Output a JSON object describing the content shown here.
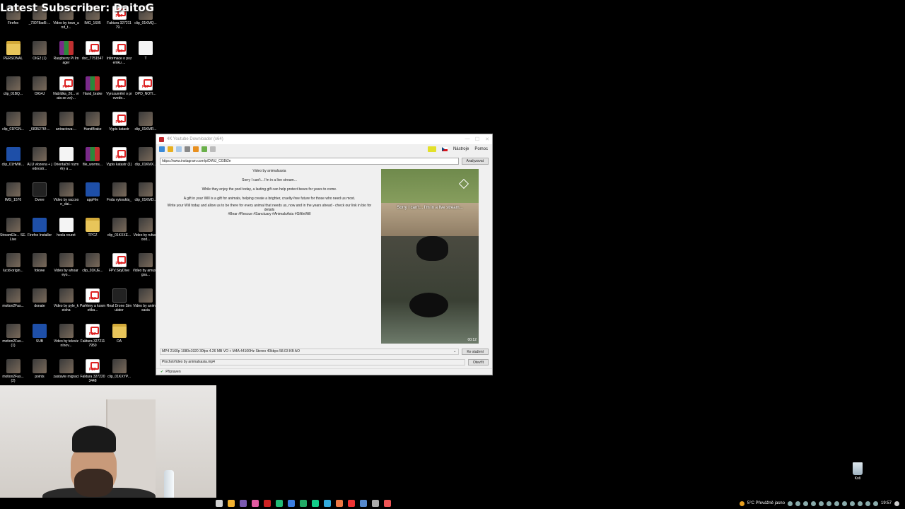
{
  "stream_overlay": {
    "latest_subscriber": "Latest Subscriber: DaitoG"
  },
  "desktop_icons": [
    {
      "label": "Firefox",
      "type": "thumb"
    },
    {
      "label": "_73078ad5-...",
      "type": "thumb"
    },
    {
      "label": "Video by tows_and_t...",
      "type": "thumb"
    },
    {
      "label": "IMG_1605",
      "type": "thumb"
    },
    {
      "label": "Faktura 32721179...",
      "type": "pdf"
    },
    {
      "label": "clip_01KMQ...",
      "type": "thumb"
    },
    {
      "label": "PERSONAL",
      "type": "folder"
    },
    {
      "label": "OIG2 (1)",
      "type": "thumb"
    },
    {
      "label": "Raspberry Pi Imager",
      "type": "rar"
    },
    {
      "label": "doc_7751547",
      "type": "pdf"
    },
    {
      "label": "Informace o pozemku ...",
      "type": "pdf"
    },
    {
      "label": "T",
      "type": "white"
    },
    {
      "label": "clip_01BQ...",
      "type": "thumb"
    },
    {
      "label": "OIG4J",
      "type": "thumb"
    },
    {
      "label": "Nabídka_26... vrata se zvý...",
      "type": "pdf"
    },
    {
      "label": "Hand_brake",
      "type": "rar"
    },
    {
      "label": "Vyrozumění o provede...",
      "type": "pdf"
    },
    {
      "label": "DPD_NOTI...",
      "type": "pdf"
    },
    {
      "label": "clip_01PGN...",
      "type": "thumb"
    },
    {
      "label": "_6835276f-...",
      "type": "thumb"
    },
    {
      "label": "antractova-...",
      "type": "thumb"
    },
    {
      "label": "HandBrake",
      "type": "thumb"
    },
    {
      "label": "Vypis katastr",
      "type": "pdf"
    },
    {
      "label": "clip_01KMR...",
      "type": "thumb"
    },
    {
      "label": "clip_01HWK...",
      "type": "blue"
    },
    {
      "label": "ALU vlozena + jednostr...",
      "type": "thumb"
    },
    {
      "label": "Orientační rozměry a ...",
      "type": "white"
    },
    {
      "label": "file_worms...",
      "type": "rar"
    },
    {
      "label": "Vypis katastr (1)",
      "type": "pdf"
    },
    {
      "label": "clip_01KMX...",
      "type": "thumb"
    },
    {
      "label": "IMG_1576",
      "type": "thumb"
    },
    {
      "label": "Dvere",
      "type": "dark"
    },
    {
      "label": "Video by raccoon_dai...",
      "type": "thumb"
    },
    {
      "label": "appFile",
      "type": "blue"
    },
    {
      "label": "Fnda vykoukla_",
      "type": "thumb"
    },
    {
      "label": "clip_01KMD...",
      "type": "thumb"
    },
    {
      "label": "StreamEle... SE.Live",
      "type": "thumb"
    },
    {
      "label": "Firefox Installer",
      "type": "blue"
    },
    {
      "label": "hesla rouret",
      "type": "white"
    },
    {
      "label": "TPCZ",
      "type": "folder"
    },
    {
      "label": "clip_01KXXE...",
      "type": "thumb"
    },
    {
      "label": "Video by rufusgood...",
      "type": "thumb"
    },
    {
      "label": "lucid-origin...",
      "type": "thumb"
    },
    {
      "label": "folowe",
      "type": "thumb"
    },
    {
      "label": "Video by whoareyo...",
      "type": "thumb"
    },
    {
      "label": "clip_01KJE...",
      "type": "thumb"
    },
    {
      "label": "FPV.SkyDive",
      "type": "pdf"
    },
    {
      "label": "Video by amusingsa...",
      "type": "thumb"
    },
    {
      "label": "motion2Fas...",
      "type": "thumb"
    },
    {
      "label": "donate",
      "type": "thumb"
    },
    {
      "label": "Video by pyle_keisha",
      "type": "thumb"
    },
    {
      "label": "Parfémy a kosmetika...",
      "type": "pdf"
    },
    {
      "label": "Real Drone Simulator",
      "type": "dark"
    },
    {
      "label": "Video by animalsasia",
      "type": "thumb"
    },
    {
      "label": "motion2Fas... (1)",
      "type": "thumb"
    },
    {
      "label": "SUB",
      "type": "blue"
    },
    {
      "label": "Video by televiznínov...",
      "type": "thumb"
    },
    {
      "label": "Faktura 3272117950",
      "type": "pdf"
    },
    {
      "label": "OA",
      "type": "folder"
    },
    {
      "label": "",
      "type": "none"
    },
    {
      "label": "motion2Fas... (2)",
      "type": "thumb"
    },
    {
      "label": "points",
      "type": "thumb"
    },
    {
      "label": "zastavte migraci",
      "type": "thumb"
    },
    {
      "label": "Faktura 3272203448",
      "type": "pdf"
    },
    {
      "label": "clip_01KXYP...",
      "type": "thumb"
    },
    {
      "label": "",
      "type": "none"
    }
  ],
  "app": {
    "title": "4K Youtube Downloader (x64)",
    "menu": {
      "tools": "Nástroje",
      "help": "Pomoc"
    },
    "url": "https://www.instagram.com/p/DWiJ_CGBi2e",
    "analyze_label": "Analyzovat",
    "description": [
      "Video by animalsasia",
      "Sorry I can't... I'm in a live stream...",
      "While they enjoy the pool today, a lasting gift can help protect bears for years to come.",
      "A gift in your Will is a gift for animals, helping create a brighter, cruelty-free future for those who need us most.",
      "Write your Will today and allow us to be there for every animal that needs us, now and in the years ahead - check our link in bio for details",
      "#Bear #Rescue #Sanctuary #AnimalsAsia #GiftInWill"
    ],
    "video": {
      "caption": "Sorry I can't... I'm in a live stream...",
      "duration": "00:12"
    },
    "format": "MP4 2160p 1080x1920 30fps 4.26 MB VO + M4A 44100Hz Stereo 40kbps 58.03 KB AO",
    "download_label": "Ke stažení",
    "path": "Plocha\\Video by animalsasia.mp4",
    "open_label": "Otevřít",
    "status": "Připraven"
  },
  "taskbar": {
    "weather": "5°C  Převážně jasno",
    "time": "19:57",
    "apps": [
      "#d0d0d0",
      "#f0b030",
      "#7a5ab0",
      "#e05aa0",
      "#c22",
      "#2b7",
      "#3a7de0",
      "#2a6",
      "#1c8",
      "#3ad",
      "#e74",
      "#e33",
      "#58c",
      "#aaa",
      "#e55"
    ]
  },
  "recycle_bin": {
    "label": "Koš"
  }
}
